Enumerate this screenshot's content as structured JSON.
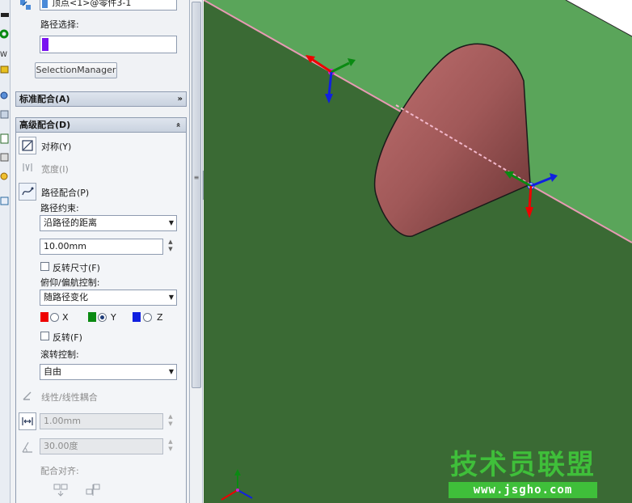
{
  "sections": {
    "top": {
      "vertex_value": "顶点<1>@零件3-1",
      "path_selection_label": "路径选择:",
      "selection_manager_label": "SelectionManager"
    },
    "standard_mates": {
      "title": "标准配合(A)"
    },
    "advanced_mates": {
      "title": "高级配合(D)",
      "symmetric_label": "对称(Y)",
      "width_label": "宽度(I)",
      "path_mate_label": "路径配合(P)",
      "path_constraint_label": "路径约束:",
      "path_constraint_value": "沿路径的距离",
      "distance_value": "10.00mm",
      "flip_dimension_label": "反转尺寸(F)",
      "pitch_yaw_label": "俯仰/偏航控制:",
      "pitch_yaw_value": "随路径变化",
      "axis_x": "X",
      "axis_y": "Y",
      "axis_z": "Z",
      "axis_selected": "Y",
      "flip_label": "反转(F)",
      "roll_label": "滚转控制:",
      "roll_value": "自由",
      "linear_coupler_label": "线性/线性耦合",
      "linear_value": "1.00mm",
      "angle_value": "30.00度",
      "mate_alignment_label": "配合对齐:"
    }
  },
  "colors": {
    "axis_x": "#ee0000",
    "axis_y": "#0a8a12",
    "axis_z": "#1020e0",
    "path_color": "#7a12f0",
    "plane_green": "#3a6a34",
    "plane_light": "#5aa55a",
    "cone": "#a05858",
    "path_line": "#e89ab4"
  },
  "icons": {
    "symmetric": "symmetric-mate-icon",
    "width": "width-mate-icon",
    "path": "path-mate-icon",
    "linear": "linear-coupler-icon",
    "distance": "distance-icon",
    "angle": "angle-icon",
    "align_a": "align-anti-icon",
    "align_b": "align-aligned-icon"
  },
  "watermark": {
    "cn": "技术员联盟",
    "url": "www.jsgho.com"
  }
}
